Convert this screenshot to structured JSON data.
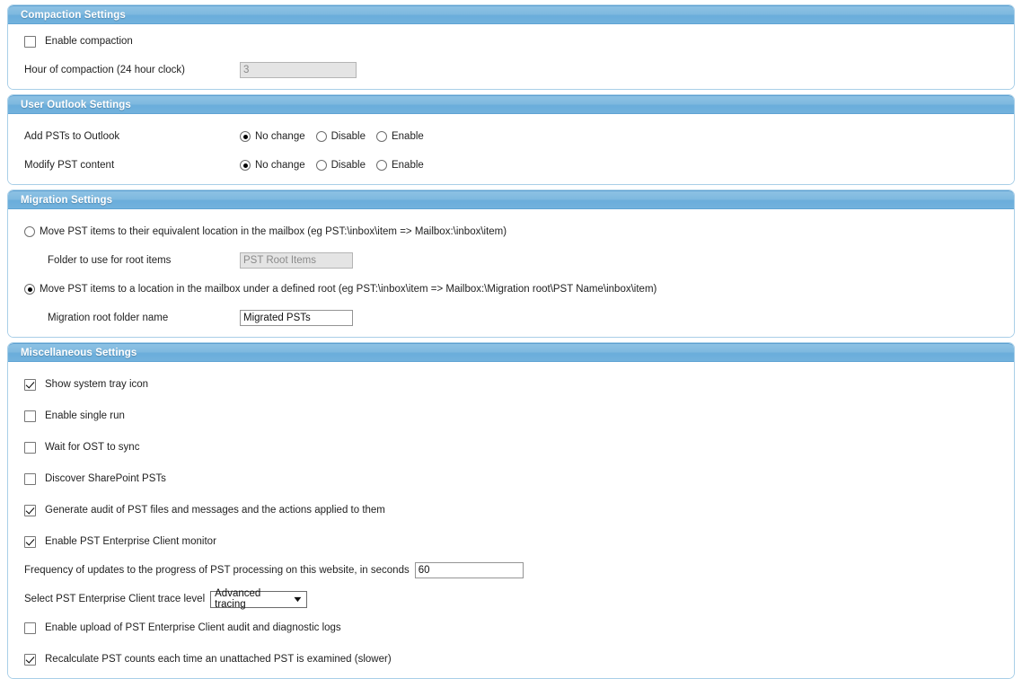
{
  "panels": {
    "compaction": {
      "title": "Compaction Settings",
      "enable_compaction": {
        "label": "Enable compaction",
        "checked": false
      },
      "hour_label": "Hour of compaction (24 hour clock)",
      "hour_value": "3",
      "hour_disabled": true
    },
    "user_outlook": {
      "title": "User Outlook Settings",
      "rows": [
        {
          "label": "Add PSTs to Outlook",
          "options": [
            "No change",
            "Disable",
            "Enable"
          ],
          "selected": "No change"
        },
        {
          "label": "Modify PST content",
          "options": [
            "No change",
            "Disable",
            "Enable"
          ],
          "selected": "No change"
        }
      ]
    },
    "migration": {
      "title": "Migration Settings",
      "option_equivalent": {
        "label": "Move PST items to their equivalent location in the mailbox (eg PST:\\inbox\\item => Mailbox:\\inbox\\item)",
        "selected": false
      },
      "root_items_label": "Folder to use for root items",
      "root_items_value": "PST Root Items",
      "root_items_disabled": true,
      "option_defined_root": {
        "label": "Move PST items to a location in the mailbox under a defined root (eg PST:\\inbox\\item => Mailbox:\\Migration root\\PST Name\\inbox\\item)",
        "selected": true
      },
      "migration_root_label": "Migration root folder name",
      "migration_root_value": "Migrated PSTs",
      "migration_root_disabled": false
    },
    "misc": {
      "title": "Miscellaneous Settings",
      "checkboxes_top": [
        {
          "label": "Show system tray icon",
          "checked": true
        },
        {
          "label": "Enable single run",
          "checked": false
        },
        {
          "label": "Wait for OST to sync",
          "checked": false
        },
        {
          "label": "Discover SharePoint PSTs",
          "checked": false
        },
        {
          "label": "Generate audit of PST files and messages and the actions applied to them",
          "checked": true
        },
        {
          "label": "Enable PST Enterprise Client monitor",
          "checked": true
        }
      ],
      "frequency_label": "Frequency of updates to the progress of PST processing on this website, in seconds",
      "frequency_value": "60",
      "trace_label": "Select PST Enterprise Client trace level",
      "trace_selected": "Advanced tracing",
      "trace_options": [
        "Advanced tracing"
      ],
      "trace_chevron": "chevron-down-icon",
      "checkboxes_bottom": [
        {
          "label": "Enable upload of PST Enterprise Client audit and diagnostic logs",
          "checked": false
        },
        {
          "label": "Recalculate PST counts each time an unattached PST is examined (slower)",
          "checked": true
        }
      ]
    }
  },
  "colors": {
    "header_blue": "#7fb9df",
    "panel_border": "#a9cfe8",
    "disabled_field": "#e4e4e4"
  }
}
